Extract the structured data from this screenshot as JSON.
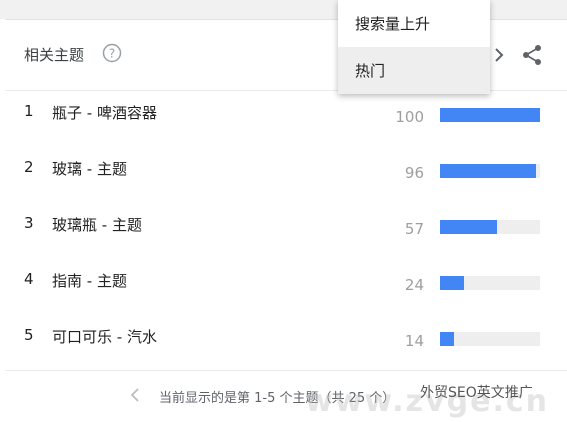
{
  "header": {
    "title": "相关主题"
  },
  "dropdown": {
    "items": [
      {
        "label": "搜索量上升"
      },
      {
        "label": "热门"
      }
    ],
    "selected_index": 1
  },
  "rows": [
    {
      "rank": "1",
      "term": "瓶子 - 啤酒容器",
      "score": "100",
      "value": 100
    },
    {
      "rank": "2",
      "term": "玻璃 - 主题",
      "score": "96",
      "value": 96
    },
    {
      "rank": "3",
      "term": "玻璃瓶 - 主题",
      "score": "57",
      "value": 57
    },
    {
      "rank": "4",
      "term": "指南 - 主题",
      "score": "24",
      "value": 24
    },
    {
      "rank": "5",
      "term": "可口可乐 - 汽水",
      "score": "14",
      "value": 14
    }
  ],
  "footer": {
    "pagination_text": "当前显示的是第 1-5 个主题（共 25 个）"
  },
  "watermark": {
    "tag": "外贸SEO英文推广",
    "text": "www.zvge.cn"
  },
  "colors": {
    "bar": "#4285f4",
    "track": "#eeeeee"
  }
}
